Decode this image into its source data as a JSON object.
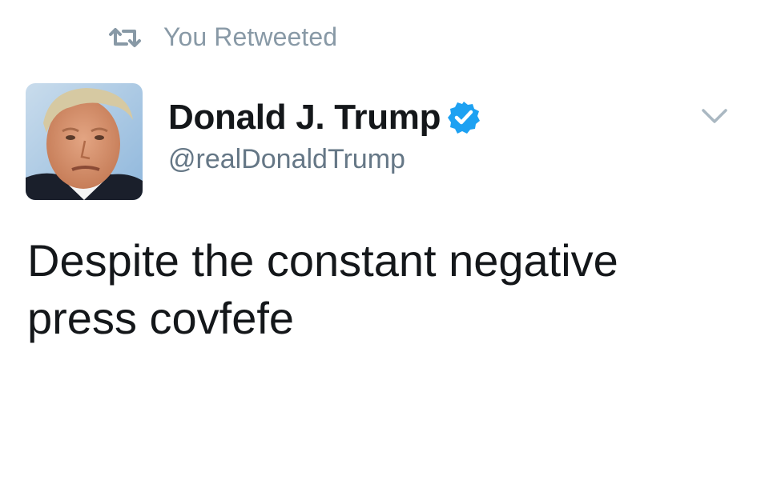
{
  "retweet_context": {
    "icon": "retweet-icon",
    "label": "You Retweeted"
  },
  "author": {
    "display_name": "Donald J. Trump",
    "handle": "@realDonaldTrump",
    "verified_icon": "verified-badge-icon",
    "avatar_icon": "profile-photo"
  },
  "tweet": {
    "text": "Despite the constant negative press covfefe"
  },
  "menu": {
    "icon": "chevron-down-icon"
  },
  "colors": {
    "verified_blue": "#1da1f2",
    "name": "#14171a",
    "muted": "#657786",
    "retweet_grey": "#8899a6"
  }
}
